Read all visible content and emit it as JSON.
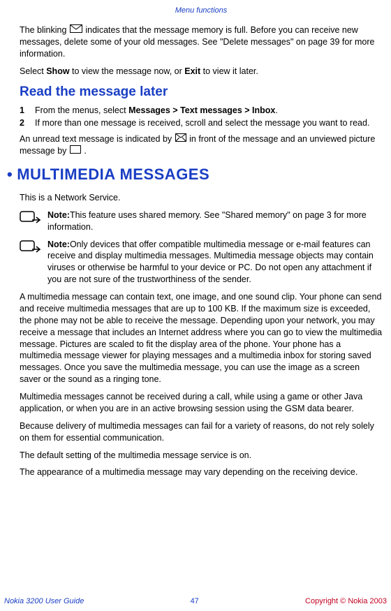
{
  "header": "Menu functions",
  "intro1a": "The blinking ",
  "intro1b": " indicates that the message memory is full. Before you can receive new messages, delete some of your old messages. See \"Delete messages\" on page 39 for more information.",
  "intro2a": "Select ",
  "intro2_show": "Show",
  "intro2b": " to view the message now, or ",
  "intro2_exit": "Exit",
  "intro2c": " to view it later.",
  "h2_read": "Read the message later",
  "step1_num": "1",
  "step1_a": "From the menus, select ",
  "step1_b": "Messages > Text messages > Inbox",
  "step1_c": ".",
  "step2_num": "2",
  "step2_txt": "If more than one message is received, scroll and select the message you want to read.",
  "unread_a": "An unread text message is indicated by ",
  "unread_b": " in front of the message and an unviewed picture message by ",
  "unread_c": ".",
  "h1_mms": "MULTIMEDIA MESSAGES",
  "mms_intro": "This is a Network Service.",
  "note1_label": "Note:",
  "note1_txt": "This feature uses shared memory. See \"Shared memory\" on page 3 for more information.",
  "note2_label": "Note:",
  "note2_txt": "Only devices that offer compatible multimedia message or e-mail features can receive and display multimedia messages. Multimedia message objects may contain viruses or otherwise be harmful to your device or PC. Do not open any attachment if you are not sure of the trustworthiness of the sender.",
  "mms_p1": "A multimedia message can contain text, one image, and one sound clip. Your phone can send and receive multimedia messages that are up to 100 KB. If the maximum size is exceeded, the phone may not be able to receive the message. Depending upon your network, you may receive a message that includes an Internet address where you can go to view the multimedia message. Pictures are scaled to fit the display area of the phone. Your phone has a multimedia message viewer for playing messages and a multimedia inbox for storing saved messages. Once you save the multimedia message, you can use the image as a screen saver or the sound as a ringing tone.",
  "mms_p2": "Multimedia messages cannot be received during a call, while using a game or other Java application, or when you are in an active browsing session using the GSM data bearer.",
  "mms_p3": "Because delivery of multimedia messages can fail for a variety of reasons, do not rely solely on them for essential communication.",
  "mms_p4": "The default setting of the multimedia message service is on.",
  "mms_p5": "The appearance of a multimedia message may vary depending on the receiving device.",
  "footer_left": "Nokia 3200 User Guide",
  "footer_center": "47",
  "footer_right": "Copyright © Nokia 2003"
}
